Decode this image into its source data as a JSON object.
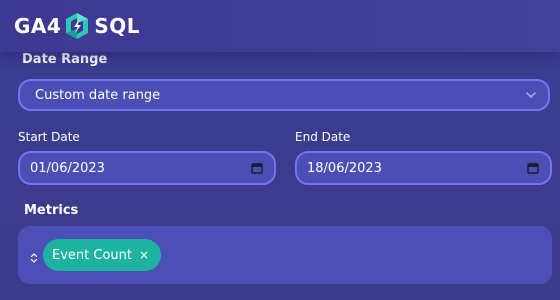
{
  "brand": {
    "left_text": "GA4",
    "right_text": "SQL",
    "logo_icon": "ga4-sql-logo-icon",
    "accent": "#2ec6b8"
  },
  "date_range": {
    "label": "Date Range",
    "value": "Custom date range",
    "icon": "chevron-down-icon"
  },
  "start_date": {
    "label": "Start Date",
    "value": "01/06/2023",
    "icon": "calendar-icon"
  },
  "end_date": {
    "label": "End Date",
    "value": "18/06/2023",
    "icon": "calendar-icon"
  },
  "metrics": {
    "label": "Metrics",
    "sort_icon": "sort-icon",
    "chips": [
      {
        "label": "Event Count",
        "remove": "×",
        "color": "#1eb3a0"
      }
    ]
  },
  "colors": {
    "field_border": "#6f76ee",
    "field_bg": "#4b4fb5",
    "background": "#3b3d93"
  }
}
